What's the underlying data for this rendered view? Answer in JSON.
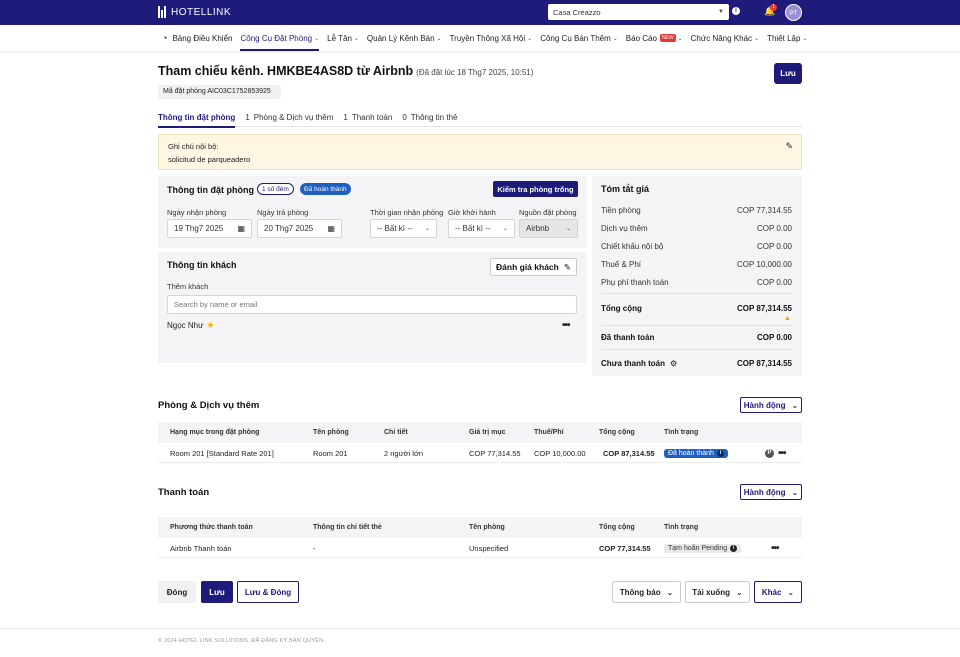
{
  "topbar": {
    "brand": "HOTELLINK",
    "hotel": "Casa Creazzo",
    "notifications": "1",
    "avatar": "PT"
  },
  "nav": [
    {
      "label": "Bảng Điều Khiển",
      "caret": false,
      "icon": "dashboard-icon"
    },
    {
      "label": "Công Cụ Đặt Phòng",
      "caret": true,
      "active": true
    },
    {
      "label": "Lễ Tân",
      "caret": true
    },
    {
      "label": "Quản Lý Kênh Bán",
      "caret": true
    },
    {
      "label": "Truyền Thông Xã Hội",
      "caret": true
    },
    {
      "label": "Công Cụ Bán Thêm",
      "caret": true
    },
    {
      "label": "Báo Cáo",
      "caret": true,
      "badge": "NEW"
    },
    {
      "label": "Chức Năng Khác",
      "caret": true
    },
    {
      "label": "Thiết Lập",
      "caret": true
    }
  ],
  "header": {
    "title": "Tham chiếu kênh. HMKBE4AS8D từ Airbnb",
    "subtitle": "(Đã đặt lúc 18 Thg7 2025, 10:51)",
    "save": "Lưu",
    "booking_code": "Mã đặt phòng AIC03C1752853925"
  },
  "tabs": [
    {
      "count": "",
      "label": "Thông tin đặt phòng"
    },
    {
      "count": "1",
      "label": "Phòng & Dịch vụ thêm"
    },
    {
      "count": "1",
      "label": "Thanh toán"
    },
    {
      "count": "0",
      "label": "Thông tin thẻ"
    }
  ],
  "note": {
    "label": "Ghi chú nội bộ:",
    "text": "solicitud de parqueadero"
  },
  "booking": {
    "title": "Thông tin đặt phòng",
    "nights": "1 số đêm",
    "status": "Đã hoàn thành",
    "check_button": "Kiểm tra phòng trống",
    "checkin_label": "Ngày nhận phòng",
    "checkin": "19 Thg7 2025",
    "checkout_label": "Ngày trả phòng",
    "checkout": "20 Thg7 2025",
    "checkin_time_label": "Thời gian nhận phòng",
    "checkin_time": "-- Bất kì --",
    "depart_time_label": "Giờ khởi hành",
    "depart_time": "-- Bất kì --",
    "source_label": "Nguồn đặt phòng",
    "source": "Airbnb"
  },
  "guest": {
    "title": "Thông tin khách",
    "review_button": "Đánh giá khách",
    "add_label": "Thêm khách",
    "search_placeholder": "Search by name or email",
    "name": "Ngọc Như"
  },
  "summary": {
    "title": "Tóm tắt giá",
    "rows": [
      {
        "label": "Tiền phòng",
        "value": "COP 77,314.55"
      },
      {
        "label": "Dịch vụ thêm",
        "value": "COP 0.00"
      },
      {
        "label": "Chiết khấu nội bộ",
        "value": "COP 0.00"
      },
      {
        "label": "Thuế & Phí",
        "value": "COP 10,000.00"
      },
      {
        "label": "Phụ phí thanh toán",
        "value": "COP 0.00"
      }
    ],
    "total_label": "Tổng cộng",
    "total": "COP 87,314.55",
    "paid_label": "Đã thanh toán",
    "paid": "COP 0.00",
    "unpaid_label": "Chưa thanh toán",
    "unpaid": "COP 87,314.55"
  },
  "rooms": {
    "title": "Phòng & Dịch vụ thêm",
    "action": "Hành động",
    "headers": [
      "Hạng mục trong đặt phòng",
      "Tên phòng",
      "Chi tiết",
      "Giá trị mục",
      "Thuế/Phí",
      "Tổng cộng",
      "Tình trạng"
    ],
    "row": {
      "item": "Room 201 [Standard Rate 201]",
      "room": "Room 201",
      "detail": "2 người lớn",
      "value": "COP 77,314.55",
      "tax": "COP 10,000.00",
      "total": "COP 87,314.55",
      "status": "Đã hoàn thành"
    }
  },
  "payments": {
    "title": "Thanh toán",
    "action": "Hành động",
    "headers": [
      "Phương thức thanh toán",
      "Thông tin chi tiết thẻ",
      "Tên phòng",
      "Tổng cộng",
      "Tình trạng"
    ],
    "row": {
      "method": "Airbnb Thanh toán",
      "card": "-",
      "room": "Unspecified",
      "total": "COP 77,314.55",
      "status": "Tạm hoãn Pending"
    }
  },
  "footer": {
    "close": "Đóng",
    "save": "Lưu",
    "save_close": "Lưu & Đóng",
    "notify": "Thông báo",
    "download": "Tải xuống",
    "other": "Khác",
    "copyright": "© 2024 HOTEL LINK SOLUTIONS. ĐÃ ĐĂNG KÝ BẢN QUYỀN."
  },
  "colors": {
    "primary": "#1f1b7a",
    "status_blue": "#1f5fbf",
    "note_bg": "#fdf6e3"
  }
}
